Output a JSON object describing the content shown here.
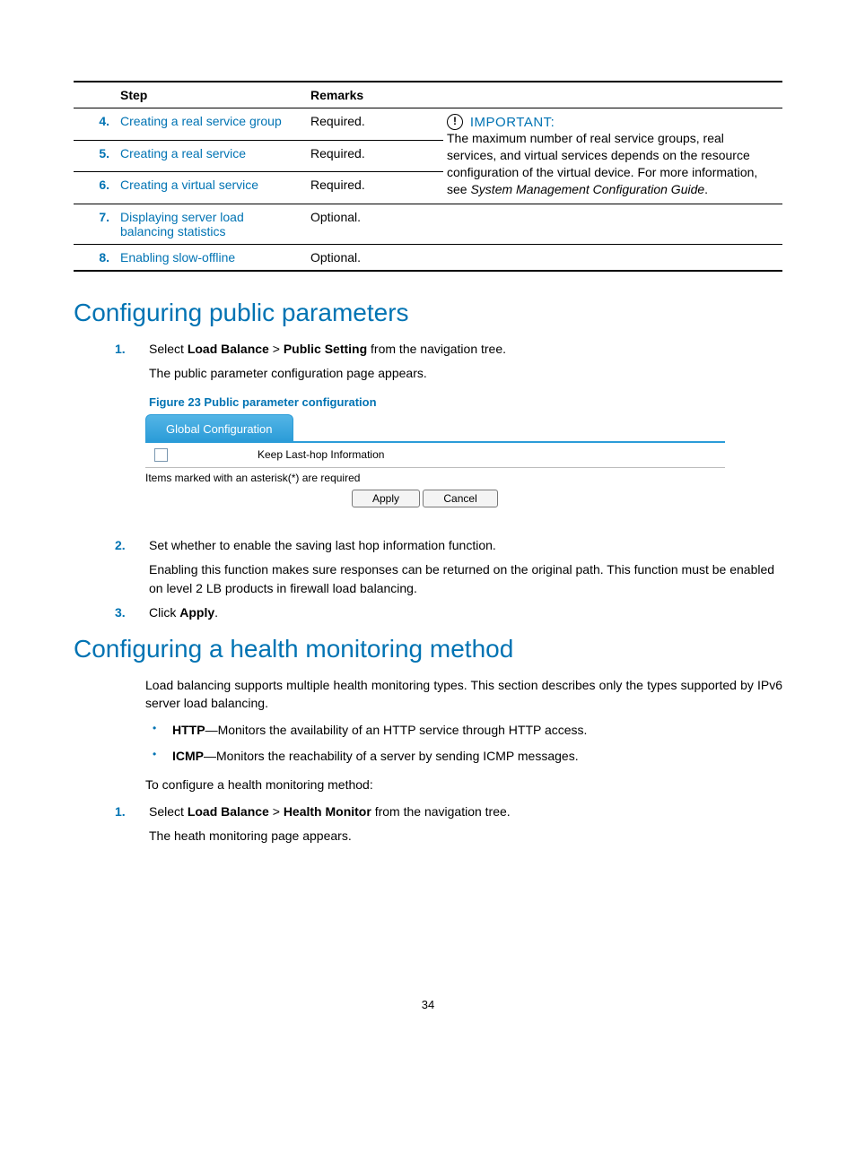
{
  "table": {
    "headers": {
      "step": "Step",
      "remarks": "Remarks"
    },
    "rows": [
      {
        "num": "4.",
        "link": "Creating a real service group",
        "remark": "Required."
      },
      {
        "num": "5.",
        "link": "Creating a real service",
        "remark": "Required."
      },
      {
        "num": "6.",
        "link": "Creating a virtual service",
        "remark": "Required."
      },
      {
        "num": "7.",
        "link": "Displaying server load balancing statistics",
        "remark": "Optional."
      },
      {
        "num": "8.",
        "link": "Enabling slow-offline",
        "remark": "Optional."
      }
    ],
    "important_label": "IMPORTANT:",
    "important_text_1": "The maximum number of real service groups, real services, and virtual services depends on the resource configuration of the virtual device. For more information, see ",
    "important_text_italic": "System Management Configuration Guide",
    "important_text_2": "."
  },
  "section1": {
    "title": "Configuring public parameters",
    "step1_a": "Select ",
    "step1_b": "Load Balance",
    "step1_c": " > ",
    "step1_d": "Public Setting",
    "step1_e": " from the navigation tree.",
    "step1_sub": "The public parameter configuration page appears.",
    "fig_caption": "Figure 23 Public parameter configuration",
    "ui": {
      "tab": "Global Configuration",
      "keep_label": "Keep Last-hop Information",
      "asterisk_note": "Items marked with an asterisk(*) are required",
      "apply": "Apply",
      "cancel": "Cancel"
    },
    "step2": "Set whether to enable the saving last hop information function.",
    "step2_sub": "Enabling this function makes sure responses can be returned on the original path. This function must be enabled on level 2 LB products in firewall load balancing.",
    "step3_a": "Click ",
    "step3_b": "Apply",
    "step3_c": "."
  },
  "section2": {
    "title": "Configuring a health monitoring method",
    "intro": "Load balancing supports multiple health monitoring types. This section describes only the types supported by IPv6 server load balancing.",
    "bullet1_b": "HTTP",
    "bullet1_t": "—Monitors the availability of an HTTP service through HTTP access.",
    "bullet2_b": "ICMP",
    "bullet2_t": "—Monitors the reachability of a server by sending ICMP messages.",
    "proc_intro": "To configure a health monitoring method:",
    "step1_a": "Select ",
    "step1_b": "Load Balance",
    "step1_c": " > ",
    "step1_d": "Health Monitor",
    "step1_e": " from the navigation tree.",
    "step1_sub": "The heath monitoring page appears."
  },
  "page_number": "34"
}
